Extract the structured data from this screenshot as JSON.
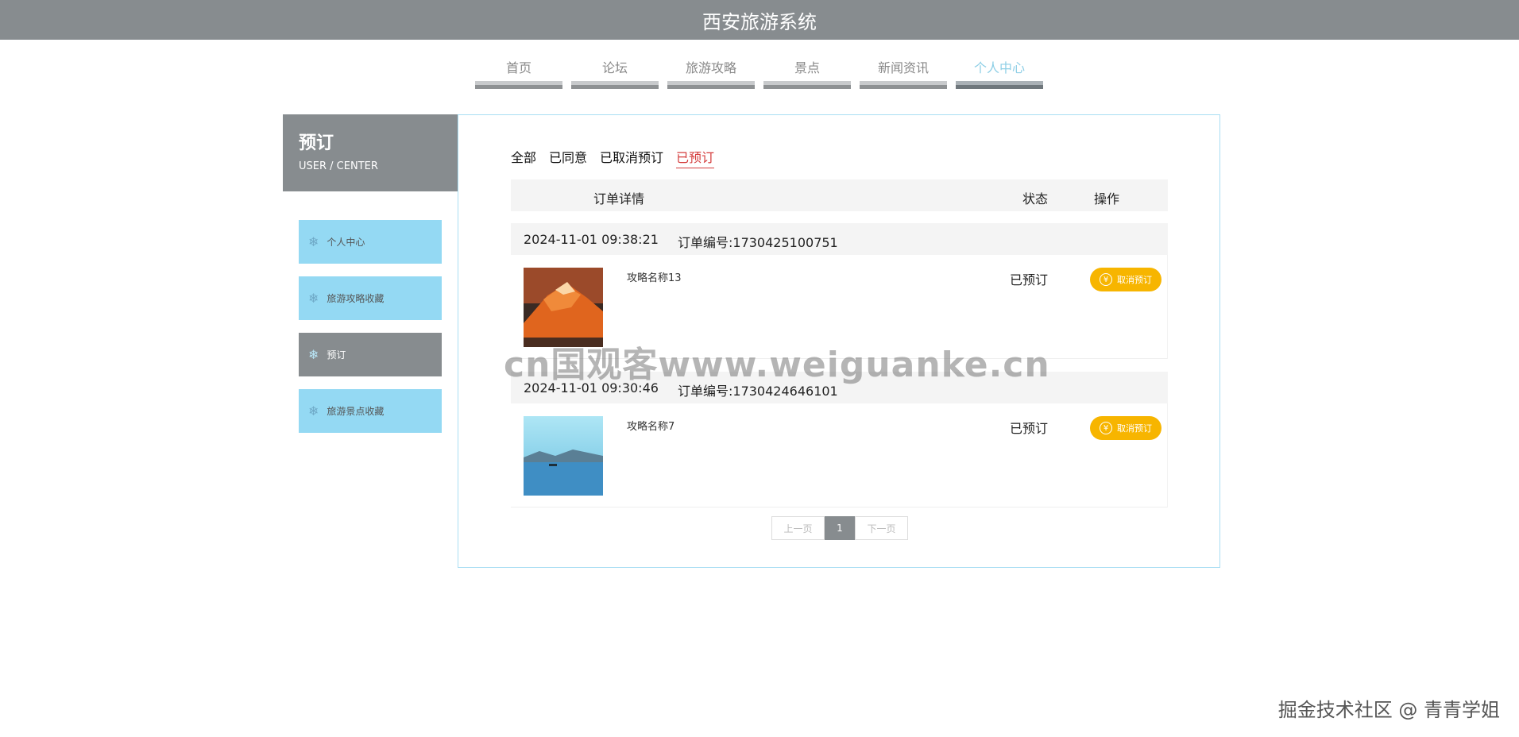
{
  "header": {
    "title": "西安旅游系统"
  },
  "nav": {
    "items": [
      {
        "label": "首页"
      },
      {
        "label": "论坛"
      },
      {
        "label": "旅游攻略"
      },
      {
        "label": "景点"
      },
      {
        "label": "新闻资讯"
      },
      {
        "label": "个人中心"
      }
    ],
    "active_index": 5
  },
  "sidebar": {
    "title": "预订",
    "subtitle": "USER / CENTER",
    "items": [
      {
        "label": "个人中心",
        "icon": "snowflake-icon"
      },
      {
        "label": "旅游攻略收藏",
        "icon": "snowflake-icon"
      },
      {
        "label": "预订",
        "icon": "snowflake-icon"
      },
      {
        "label": "旅游景点收藏",
        "icon": "snowflake-icon"
      }
    ],
    "active_index": 2
  },
  "filters": {
    "items": [
      {
        "label": "全部"
      },
      {
        "label": "已同意"
      },
      {
        "label": "已取消预订"
      },
      {
        "label": "已预订"
      }
    ],
    "active_index": 3
  },
  "table": {
    "col_detail": "订单详情",
    "col_status": "状态",
    "col_action": "操作"
  },
  "orders": [
    {
      "time": "2024-11-01 09:38:21",
      "order_no": "订单编号:1730425100751",
      "name": "攻略名称13",
      "status": "已预订",
      "action": "取消预订",
      "thumb": "mountain-sunset"
    },
    {
      "time": "2024-11-01 09:30:46",
      "order_no": "订单编号:1730424646101",
      "name": "攻略名称7",
      "status": "已预订",
      "action": "取消预订",
      "thumb": "lake-boat"
    }
  ],
  "pagination": {
    "prev": "上一页",
    "current": "1",
    "next": "下一页"
  },
  "watermark": "cn国观客www.weiguanke.cn",
  "credit": "掘金技术社区 @ 青青学姐",
  "colors": {
    "topbar": "#878c8f",
    "nav_active": "#8ecfe6",
    "side_item": "#94d9f3",
    "accent_red": "#d43c3c",
    "button": "#f7b500",
    "panel_border": "#a9def3"
  }
}
